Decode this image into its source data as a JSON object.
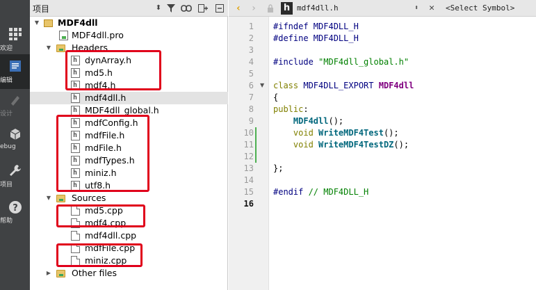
{
  "modebar": {
    "items": [
      {
        "label": "欢迎",
        "icon": "grid-icon"
      },
      {
        "label": "编辑",
        "icon": "edit-icon"
      },
      {
        "label": "设计",
        "icon": "design-icon"
      },
      {
        "label": "ebug",
        "icon": "debug-icon"
      },
      {
        "label": "项目",
        "icon": "wrench-icon"
      },
      {
        "label": "帮助",
        "icon": "help-icon"
      }
    ]
  },
  "project": {
    "title": "项目",
    "tree": [
      {
        "label": "MDF4dll",
        "type": "project",
        "expanded": true
      },
      {
        "label": "MDF4dll.pro",
        "type": "pro"
      },
      {
        "label": "Headers",
        "type": "folder",
        "expanded": true
      },
      {
        "label": "dynArray.h",
        "type": "header"
      },
      {
        "label": "md5.h",
        "type": "header"
      },
      {
        "label": "mdf4.h",
        "type": "header"
      },
      {
        "label": "mdf4dll.h",
        "type": "header",
        "selected": true
      },
      {
        "label": "MDF4dll_global.h",
        "type": "header"
      },
      {
        "label": "mdfConfig.h",
        "type": "header"
      },
      {
        "label": "mdfFile.h",
        "type": "header"
      },
      {
        "label": "mdFile.h",
        "type": "header"
      },
      {
        "label": "mdfTypes.h",
        "type": "header"
      },
      {
        "label": "miniz.h",
        "type": "header"
      },
      {
        "label": "utf8.h",
        "type": "header"
      },
      {
        "label": "Sources",
        "type": "folder",
        "expanded": true
      },
      {
        "label": "md5.cpp",
        "type": "source"
      },
      {
        "label": "mdf4.cpp",
        "type": "source"
      },
      {
        "label": "mdf4dll.cpp",
        "type": "source"
      },
      {
        "label": "mdfFile.cpp",
        "type": "source"
      },
      {
        "label": "miniz.cpp",
        "type": "source"
      },
      {
        "label": "Other files",
        "type": "folder",
        "expanded": false
      }
    ]
  },
  "editor": {
    "filename": "mdf4dll.h",
    "symbol_placeholder": "<Select Symbol>",
    "current_line": 16,
    "line_numbers": [
      "1",
      "2",
      "3",
      "4",
      "5",
      "6",
      "7",
      "8",
      "9",
      "10",
      "11",
      "12",
      "13",
      "14",
      "15",
      "16"
    ],
    "lines": [
      [
        {
          "t": "#ifndef MDF4DLL_H",
          "c": "pp"
        }
      ],
      [
        {
          "t": "#define MDF4DLL_H",
          "c": "pp"
        }
      ],
      [],
      [
        {
          "t": "#include ",
          "c": "pp"
        },
        {
          "t": "\"MDF4dll_global.h\"",
          "c": "str"
        }
      ],
      [],
      [
        {
          "t": "class ",
          "c": "kw"
        },
        {
          "t": "MDF4DLL_EXPORT ",
          "c": "macro"
        },
        {
          "t": "MDF4dll",
          "c": "cls"
        }
      ],
      [
        {
          "t": "{",
          "c": "plain"
        }
      ],
      [
        {
          "t": "public",
          "c": "kw"
        },
        {
          "t": ":",
          "c": "plain"
        }
      ],
      [
        {
          "t": "    ",
          "c": "plain"
        },
        {
          "t": "MDF4dll",
          "c": "fn"
        },
        {
          "t": "();",
          "c": "plain"
        }
      ],
      [
        {
          "t": "    ",
          "c": "plain"
        },
        {
          "t": "void ",
          "c": "kw"
        },
        {
          "t": "WriteMDF4Test",
          "c": "fn"
        },
        {
          "t": "();",
          "c": "plain"
        }
      ],
      [
        {
          "t": "    ",
          "c": "plain"
        },
        {
          "t": "void ",
          "c": "kw"
        },
        {
          "t": "WriteMDF4TestDZ",
          "c": "fn"
        },
        {
          "t": "();",
          "c": "plain"
        }
      ],
      [],
      [
        {
          "t": "};",
          "c": "plain"
        }
      ],
      [],
      [
        {
          "t": "#endif ",
          "c": "pp"
        },
        {
          "t": "// MDF4DLL_H",
          "c": "cmt"
        }
      ],
      []
    ]
  }
}
